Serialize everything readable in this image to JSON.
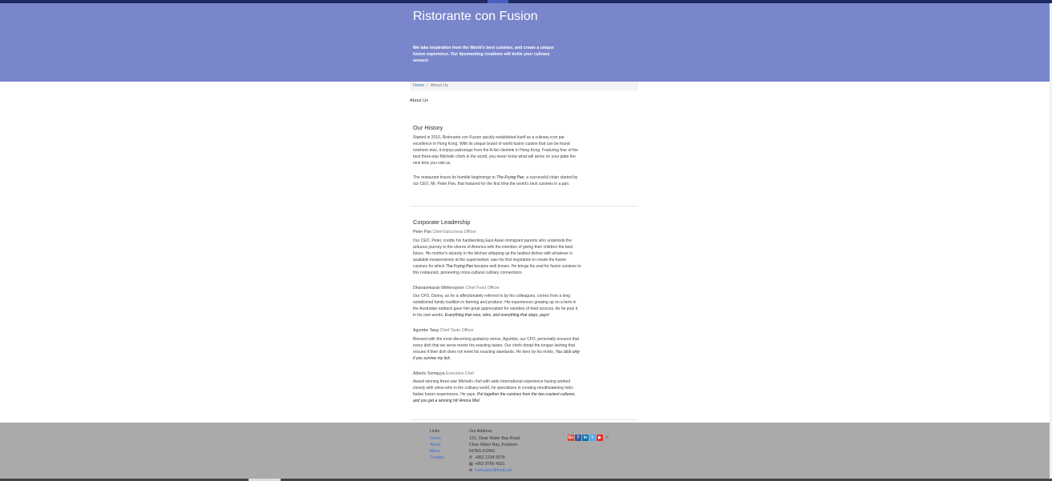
{
  "header": {
    "brand": "Ristorante con Fusion",
    "tagline": "We take inspiration from the World's best cuisines, and create a unique fusion experience. Our lipsmacking creations will tickle your culinary senses!"
  },
  "breadcrumb": {
    "home": "Home",
    "separator": "/",
    "current": "About Us"
  },
  "page_heading": "About Us",
  "history": {
    "title": "Our History",
    "para1": "Started in 2010, Ristorante con Fusion quickly established itself as a culinary icon par excellence in Hong Kong. With its unique brand of world fusion cuisine that can be found nowhere else, it enjoys patronage from the A-list clientele in Hong Kong. Featuring four of the best three-star Michelin chefs in the world, you never know what will arrive on your plate the next time you visit us.",
    "para2_before": "The restaurant traces its humble beginnings to ",
    "para2_em": "The Frying Pan",
    "para2_after": ", a successful chain started by our CEO, Mr. Peter Pan, that featured for the first time the world's best cuisines in a pan."
  },
  "leadership": {
    "title": "Corporate Leadership",
    "leaders": [
      {
        "name": "Peter Pan",
        "role": "Chief Epicurious Officer",
        "desc_before": "Our CEO, Peter, credits his hardworking East Asian immigrant parents who undertook the arduous journey to the shores of America with the intention of giving their children the best future. His mother's wizardy in the kitchen whipping up the tastiest dishes with whatever is available inexpensively at the supermarket, was his first inspiration to create the fusion cuisines for which ",
        "desc_em": "The Frying Pan",
        "desc_after": " became well known. He brings his zeal for fusion cuisines to this restaurant, pioneering cross-cultural culinary connections."
      },
      {
        "name": "Dhanasekaran Witherspoon",
        "role": "Chief Food Officer",
        "desc_before": "Our CFO, Danny, as he is affectionately referred to by his colleagues, comes from a long established family tradition in farming and produce. His experiences growing up on a farm in the Australian outback gave him great appreciation for varieties of food sources. As he puts it in his own words, ",
        "desc_em": "Everything that runs, wins, and everything that stays, pays!",
        "desc_after": ""
      },
      {
        "name": "Agumbe Tang",
        "role": "Chief Taste Officer",
        "desc_before": "Blessed with the most discerning gustatory sense, Agumbe, our CFO, personally ensures that every dish that we serve meets his exacting tastes. Our chefs dread the tongue lashing that ensues if their dish does not meet his exacting standards. He lives by his motto, ",
        "desc_em": "You click only if you survive my lick.",
        "desc_after": ""
      },
      {
        "name": "Alberto Somayya",
        "role": "Executive Chef",
        "desc_before": "Award winning three-star Michelin chef with wide International experience having worked closely with whos-who in the culinary world, he specializes in creating mouthwatering Indo-Italian fusion experiences. He says, ",
        "desc_em": "Put together the cuisines from the two craziest cultures, and you get a winning hit! Amma Mia!",
        "desc_after": ""
      }
    ]
  },
  "footer": {
    "links_title": "Links",
    "links": [
      "Home",
      "About",
      "Menu",
      "Contact"
    ],
    "address_title": "Our Address",
    "address_lines": [
      "121, Clear Water Bay Road",
      "Clear Water Bay, Kowloon",
      "HONG KONG"
    ],
    "phone": "+852 1234 5678",
    "fax": "+852 8765 4321",
    "email": "confusion@food.net",
    "social": [
      {
        "icon": "google-plus-icon",
        "glyph": "G+",
        "color": "#dd4b39"
      },
      {
        "icon": "facebook-icon",
        "glyph": "f",
        "color": "#3b5998"
      },
      {
        "icon": "linkedin-icon",
        "glyph": "in",
        "color": "#0077b5"
      },
      {
        "icon": "twitter-icon",
        "glyph": "t",
        "color": "#55acee"
      },
      {
        "icon": "youtube-icon",
        "glyph": "▶",
        "color": "#e52d27"
      },
      {
        "icon": "mail-icon",
        "glyph": "✉",
        "color": "transparent"
      }
    ]
  },
  "colors": {
    "header_bg": "#7986cb",
    "footer_bg": "#aaaaaa",
    "link": "#337ab7"
  }
}
